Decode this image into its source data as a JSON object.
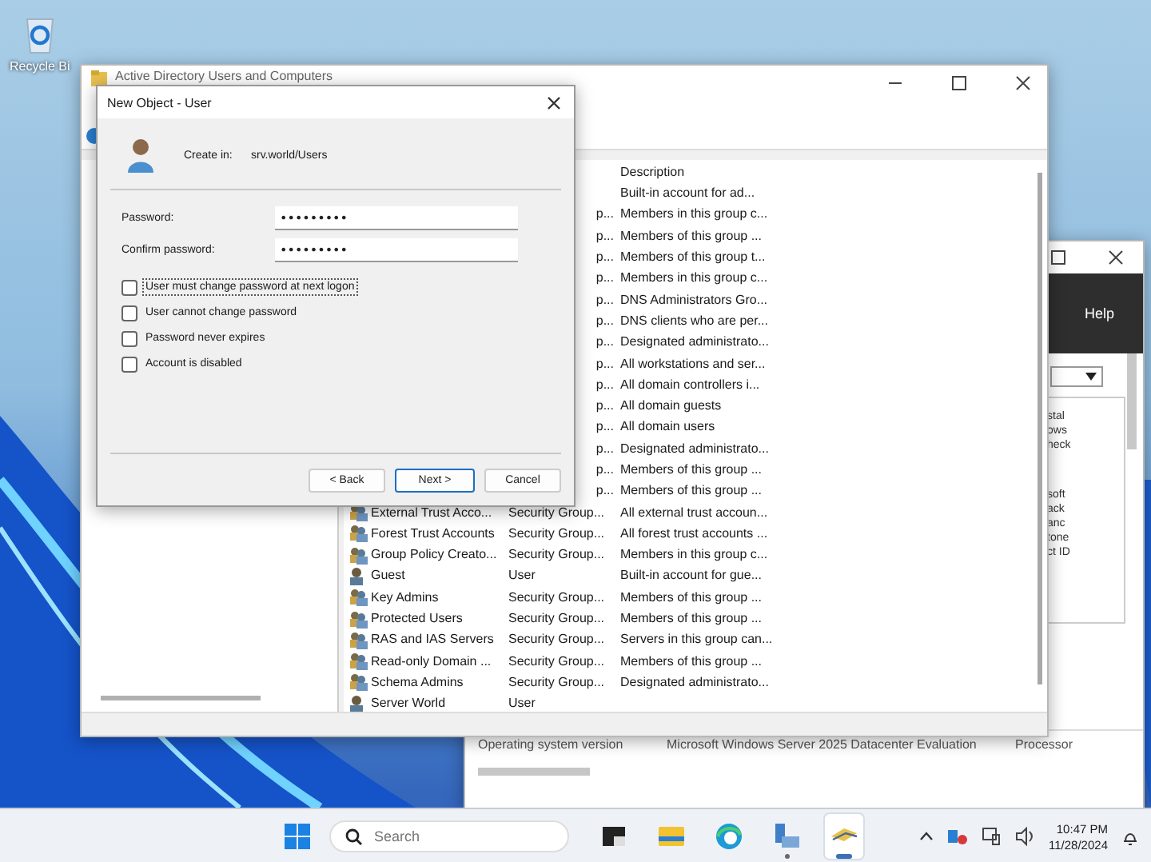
{
  "desktop": {
    "icons": [
      {
        "label": "Recycle Bi"
      }
    ]
  },
  "back_window": {
    "menu": [
      "Help"
    ],
    "side_texts": [
      "stal",
      "ows",
      "heck",
      "soft",
      "ack",
      "anc",
      "tone",
      "ct ID"
    ],
    "properties": [
      [
        "Operating system version",
        "Microsoft Windows Server 2025 Datacenter Evaluation",
        "Processor"
      ]
    ]
  },
  "main_window": {
    "title": "Active Directory Users and Computers",
    "table": {
      "columns": [
        "Description"
      ],
      "rows": [
        {
          "description": "Built-in account for ad..."
        },
        {
          "type": "p...",
          "description": "Members in this group c..."
        },
        {
          "type": "p...",
          "description": "Members of this group ..."
        },
        {
          "type": "p...",
          "description": "Members of this group t..."
        },
        {
          "type": "p...",
          "description": "Members in this group c..."
        },
        {
          "type": "p...",
          "description": "DNS Administrators Gro..."
        },
        {
          "type": "p...",
          "description": "DNS clients who are per..."
        },
        {
          "type": "p...",
          "description": "Designated administrato..."
        },
        {
          "type": "p...",
          "description": "All workstations and ser..."
        },
        {
          "type": "p...",
          "description": "All domain controllers i..."
        },
        {
          "type": "p...",
          "description": "All domain guests"
        },
        {
          "type": "p...",
          "description": "All domain users"
        },
        {
          "type": "p...",
          "description": "Designated administrato..."
        },
        {
          "type": "p...",
          "description": "Members of this group ..."
        },
        {
          "type": "p...",
          "description": "Members of this group ..."
        },
        {
          "kind": "group",
          "name": "External Trust Acco...",
          "type": "Security Group...",
          "description": "All external trust accoun..."
        },
        {
          "kind": "group",
          "name": "Forest Trust Accounts",
          "type": "Security Group...",
          "description": "All forest trust accounts ..."
        },
        {
          "kind": "group",
          "name": "Group Policy Creato...",
          "type": "Security Group...",
          "description": "Members in this group c..."
        },
        {
          "kind": "user",
          "name": "Guest",
          "type": "User",
          "description": "Built-in account for gue..."
        },
        {
          "kind": "group",
          "name": "Key Admins",
          "type": "Security Group...",
          "description": "Members of this group ..."
        },
        {
          "kind": "group",
          "name": "Protected Users",
          "type": "Security Group...",
          "description": "Members of this group ..."
        },
        {
          "kind": "group",
          "name": "RAS and IAS Servers",
          "type": "Security Group...",
          "description": "Servers in this group can..."
        },
        {
          "kind": "group",
          "name": "Read-only Domain ...",
          "type": "Security Group...",
          "description": "Members of this group ..."
        },
        {
          "kind": "group",
          "name": "Schema Admins",
          "type": "Security Group...",
          "description": "Designated administrato..."
        },
        {
          "kind": "user",
          "name": "Server World",
          "type": "User"
        }
      ]
    }
  },
  "dialog": {
    "title": "New Object - User",
    "create_in_label": "Create in:",
    "create_in_value": "srv.world/Users",
    "fields": [
      {
        "label": "Password:",
        "value": "•••••••••"
      },
      {
        "label": "Confirm password:",
        "value": "•••••••••"
      }
    ],
    "options": [
      {
        "label": "User must change password at next logon",
        "checked": false,
        "focused": true
      },
      {
        "label": "User cannot change password",
        "checked": false,
        "focused": false
      },
      {
        "label": "Password never expires",
        "checked": false,
        "focused": false
      },
      {
        "label": "Account is disabled",
        "checked": false,
        "focused": false
      }
    ],
    "buttons": [
      {
        "label": "< Back",
        "default": false
      },
      {
        "label": "Next >",
        "default": true
      },
      {
        "label": "Cancel",
        "default": false
      }
    ]
  },
  "taskbar": {
    "search": {
      "placeholder": "Search"
    },
    "apps": [
      {
        "kind": "terminal",
        "running": false,
        "selected": false
      },
      {
        "kind": "folder",
        "running": false,
        "selected": false
      },
      {
        "kind": "browser",
        "running": false,
        "selected": false
      },
      {
        "kind": "server",
        "running": true,
        "selected": false
      },
      {
        "kind": "directory",
        "running": true,
        "selected": true
      }
    ],
    "clock": {
      "time": "10:47 PM",
      "date": "11/28/2024"
    }
  }
}
